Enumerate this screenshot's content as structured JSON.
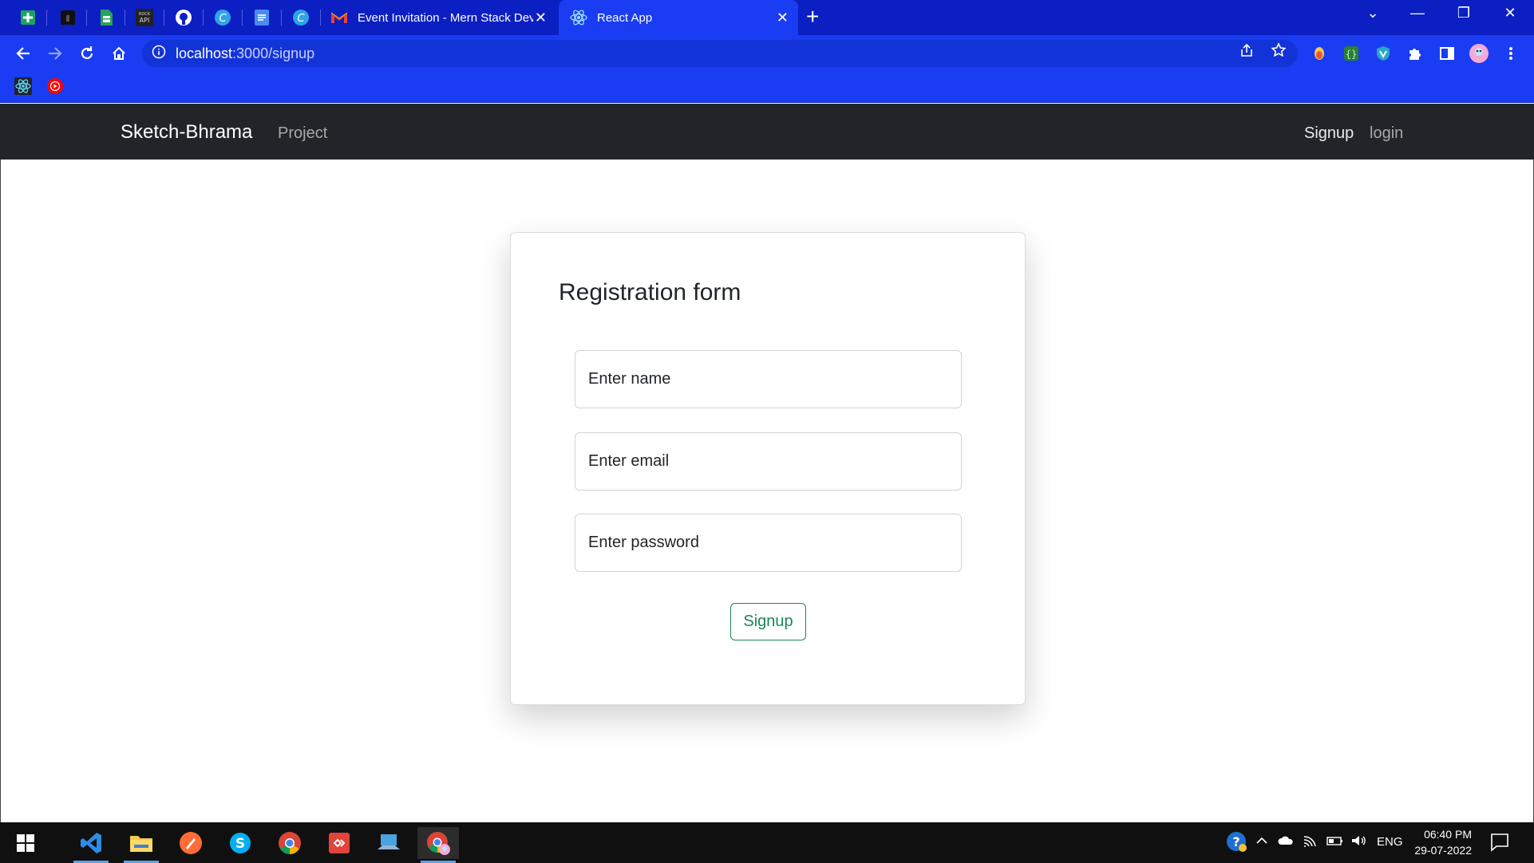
{
  "browser": {
    "tabs": [
      {
        "title": "Event Invitation - Mern Stack Dev",
        "icon": "gmail-icon"
      },
      {
        "title": "React App",
        "icon": "react-icon"
      }
    ],
    "pinned_tab_icons": [
      "sheets-icon",
      "dark-app-icon",
      "sheets-green-icon",
      "rock-api-icon",
      "github-icon",
      "c-app-icon",
      "docs-icon",
      "c-app-icon"
    ],
    "address": {
      "host": "localhost",
      "path": ":3000/signup"
    },
    "accent_color": "#1a3cf2"
  },
  "app": {
    "brand": "Sketch-Bhrama",
    "nav_left": [
      "Project"
    ],
    "nav_right": {
      "signup": "Signup",
      "login": "login"
    },
    "form": {
      "title": "Registration form",
      "name_placeholder": "Enter name",
      "email_placeholder": "Enter email",
      "password_placeholder": "Enter password",
      "submit_label": "Signup",
      "submit_color": "#198754"
    }
  },
  "taskbar": {
    "apps": [
      "vscode-icon",
      "file-explorer-icon",
      "postman-icon",
      "skype-icon",
      "chrome-icon",
      "git-icon",
      "laptop-app-icon",
      "chrome-profile-icon"
    ],
    "language": "ENG",
    "time": "06:40 PM",
    "date": "29-07-2022"
  }
}
